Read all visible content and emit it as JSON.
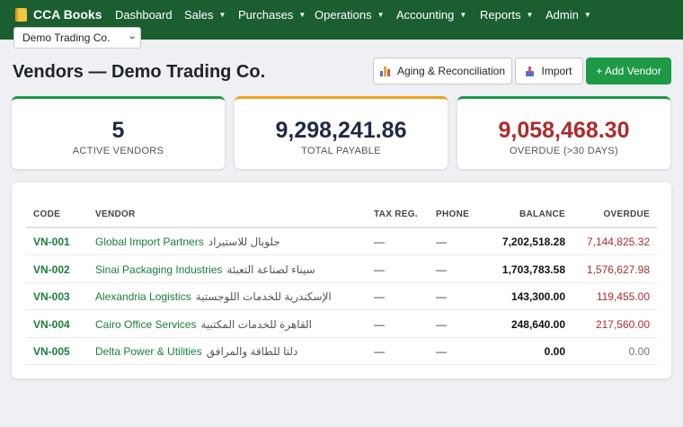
{
  "app": {
    "name": "CCA Books"
  },
  "nav": [
    {
      "label": "Dashboard",
      "caret": false
    },
    {
      "label": "Sales",
      "caret": true
    },
    {
      "label": "Purchases",
      "caret": true
    },
    {
      "label": "Operations",
      "caret": true
    },
    {
      "label": "Accounting",
      "caret": true
    },
    {
      "label": "Reports",
      "caret": true
    },
    {
      "label": "Admin",
      "caret": true
    }
  ],
  "company_selector": {
    "value": "Demo Trading Co."
  },
  "page": {
    "title": "Vendors — Demo Trading Co."
  },
  "actions": {
    "aging": "Aging & Reconciliation",
    "import": "Import",
    "add": "+ Add Vendor"
  },
  "stats": [
    {
      "value": "5",
      "label": "ACTIVE VENDORS",
      "accent": "#1e9a46",
      "value_color": "#1f2a44"
    },
    {
      "value": "9,298,241.86",
      "label": "TOTAL PAYABLE",
      "accent": "#f0a21c",
      "value_color": "#1f2a44"
    },
    {
      "value": "9,058,468.30",
      "label": "OVERDUE (>30 DAYS)",
      "accent": "#1e9a46",
      "value_color": "#b02a2a"
    }
  ],
  "table": {
    "headers": {
      "code": "CODE",
      "vendor": "VENDOR",
      "tax": "TAX REG.",
      "phone": "PHONE",
      "balance": "BALANCE",
      "overdue": "OVERDUE"
    },
    "rows": [
      {
        "code": "VN-001",
        "name": "Global Import Partners",
        "name_ar": "جلوبال للاستيراد",
        "tax": "—",
        "phone": "—",
        "balance": "7,202,518.28",
        "overdue": "7,144,825.32"
      },
      {
        "code": "VN-002",
        "name": "Sinai Packaging Industries",
        "name_ar": "سيناء لصناعة التعبئة",
        "tax": "—",
        "phone": "—",
        "balance": "1,703,783.58",
        "overdue": "1,576,627.98"
      },
      {
        "code": "VN-003",
        "name": "Alexandria Logistics",
        "name_ar": "الإسكندرية للخدمات اللوجستية",
        "tax": "—",
        "phone": "—",
        "balance": "143,300.00",
        "overdue": "119,455.00"
      },
      {
        "code": "VN-004",
        "name": "Cairo Office Services",
        "name_ar": "القاهرة للخدمات المكتبية",
        "tax": "—",
        "phone": "—",
        "balance": "248,640.00",
        "overdue": "217,560.00"
      },
      {
        "code": "VN-005",
        "name": "Delta Power & Utilities",
        "name_ar": "دلتا للطاقة والمرافق",
        "tax": "—",
        "phone": "—",
        "balance": "0.00",
        "overdue": "0.00"
      }
    ]
  },
  "colors": {
    "topbar": "#1b5e30",
    "primary": "#1e9a46",
    "link": "#1a7f3a",
    "overdue": "#b02a2a",
    "zero": "#6c757d"
  }
}
